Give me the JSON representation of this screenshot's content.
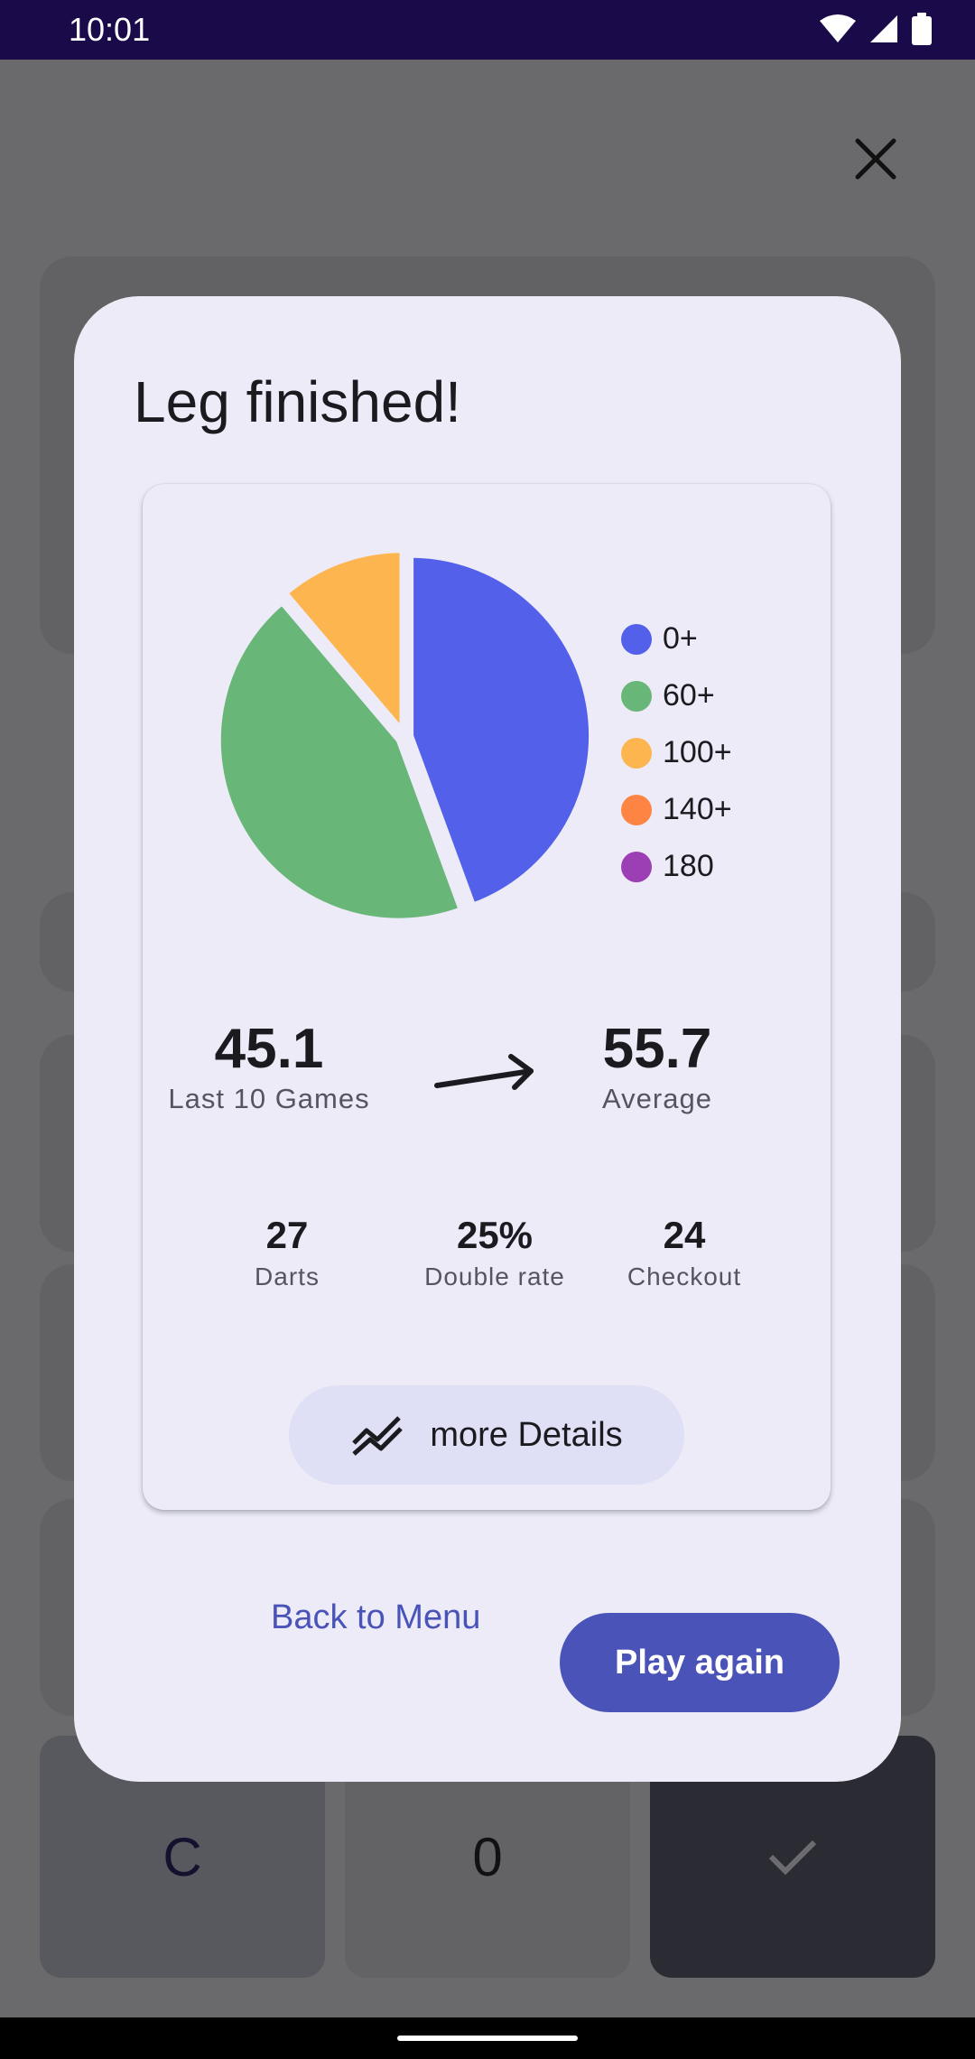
{
  "status_bar": {
    "time": "10:01"
  },
  "background": {
    "key_c": "C",
    "key_0": "0"
  },
  "dialog": {
    "title": "Leg finished!",
    "stats": {
      "last10": {
        "value": "45.1",
        "label": "Last 10 Games"
      },
      "average": {
        "value": "55.7",
        "label": "Average"
      },
      "darts": {
        "value": "27",
        "label": "Darts"
      },
      "double_rate": {
        "value": "25%",
        "label": "Double rate"
      },
      "checkout": {
        "value": "24",
        "label": "Checkout"
      }
    },
    "details_button": "more Details",
    "back_button": "Back to Menu",
    "play_button": "Play again"
  },
  "chart_data": {
    "type": "pie",
    "categories": [
      "0+",
      "60+",
      "100+",
      "140+",
      "180"
    ],
    "values": [
      44.4,
      44.4,
      11.2,
      0,
      0
    ],
    "colors": [
      "#5260ea",
      "#68b678",
      "#fdb550",
      "#fe8444",
      "#9c3eb4"
    ]
  }
}
